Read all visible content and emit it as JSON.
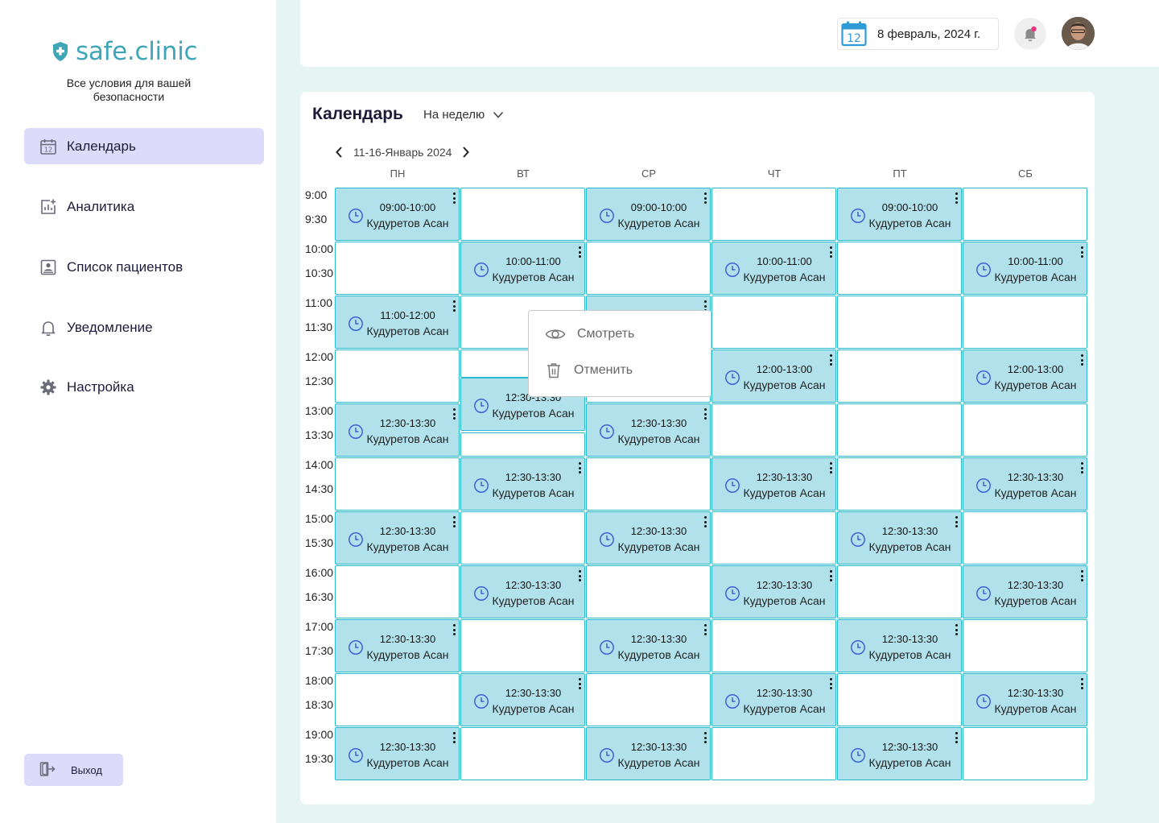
{
  "brand": {
    "name": "safe.clinic",
    "tagline": "Все условия для вашей безопасности",
    "color": "#3fa6b8"
  },
  "nav": {
    "items": [
      {
        "label": "Календарь",
        "icon": "calendar-icon",
        "active": true
      },
      {
        "label": "Аналитика",
        "icon": "analytics-icon",
        "active": false
      },
      {
        "label": "Список пациентов",
        "icon": "patients-list-icon",
        "active": false
      },
      {
        "label": "Уведомление",
        "icon": "bell-icon",
        "active": false
      },
      {
        "label": "Настройка",
        "icon": "gear-icon",
        "active": false
      }
    ],
    "logout_label": "Выход"
  },
  "header": {
    "date": "8 февраль, 2024 г.",
    "date_icon_day": "12",
    "notification_badge": true
  },
  "calendar": {
    "title": "Календарь",
    "view": "На неделю",
    "week_range": "11-16-Январь 2024",
    "days": [
      "ПН",
      "ВТ",
      "СР",
      "ЧТ",
      "ПТ",
      "СБ"
    ],
    "times": [
      "9:00",
      "9:30",
      "10:00",
      "10:30",
      "11:00",
      "11:30",
      "12:00",
      "12:30",
      "13:00",
      "13:30",
      "14:00",
      "14:30",
      "15:00",
      "15:30",
      "16:00",
      "16:30",
      "17:00",
      "17:30",
      "18:00",
      "18:30",
      "19:00",
      "19:30"
    ],
    "rows": [
      [
        {
          "time": "09:00-10:00",
          "name": "Кудуретов Асан"
        },
        null,
        {
          "time": "09:00-10:00",
          "name": "Кудуретов Асан"
        },
        null,
        {
          "time": "09:00-10:00",
          "name": "Кудуретов Асан"
        },
        null
      ],
      [
        null,
        {
          "time": "10:00-11:00",
          "name": "Кудуретов Асан"
        },
        null,
        {
          "time": "10:00-11:00",
          "name": "Кудуретов Асан"
        },
        null,
        {
          "time": "10:00-11:00",
          "name": "Кудуретов Асан"
        }
      ],
      [
        {
          "time": "11:00-12:00",
          "name": "Кудуретов Асан"
        },
        null,
        {
          "time": "",
          "name": ""
        },
        null,
        null,
        null
      ],
      [
        null,
        null,
        null,
        {
          "time": "12:00-13:00",
          "name": "Кудуретов Асан"
        },
        null,
        {
          "time": "12:00-13:00",
          "name": "Кудуретов Асан"
        }
      ],
      [
        {
          "time": "12:30-13:30",
          "name": "Кудуретов Асан"
        },
        null,
        {
          "time": "12:30-13:30",
          "name": "Кудуретов Асан"
        },
        null,
        null,
        null
      ],
      [
        null,
        {
          "time": "12:30-13:30",
          "name": "Кудуретов Асан"
        },
        null,
        {
          "time": "12:30-13:30",
          "name": "Кудуретов Асан"
        },
        null,
        {
          "time": "12:30-13:30",
          "name": "Кудуретов Асан"
        }
      ],
      [
        {
          "time": "12:30-13:30",
          "name": "Кудуретов Асан"
        },
        null,
        {
          "time": "12:30-13:30",
          "name": "Кудуретов Асан"
        },
        null,
        {
          "time": "12:30-13:30",
          "name": "Кудуретов Асан"
        },
        null
      ],
      [
        null,
        {
          "time": "12:30-13:30",
          "name": "Кудуретов Асан"
        },
        null,
        {
          "time": "12:30-13:30",
          "name": "Кудуретов Асан"
        },
        null,
        {
          "time": "12:30-13:30",
          "name": "Кудуретов Асан"
        }
      ],
      [
        {
          "time": "12:30-13:30",
          "name": "Кудуретов Асан"
        },
        null,
        {
          "time": "12:30-13:30",
          "name": "Кудуретов Асан"
        },
        null,
        {
          "time": "12:30-13:30",
          "name": "Кудуретов Асан"
        },
        null
      ],
      [
        null,
        {
          "time": "12:30-13:30",
          "name": "Кудуретов Асан"
        },
        null,
        {
          "time": "12:30-13:30",
          "name": "Кудуретов Асан"
        },
        null,
        {
          "time": "12:30-13:30",
          "name": "Кудуретов Асан"
        }
      ],
      [
        {
          "time": "12:30-13:30",
          "name": "Кудуретов Асан"
        },
        null,
        {
          "time": "12:30-13:30",
          "name": "Кудуретов Асан"
        },
        null,
        {
          "time": "12:30-13:30",
          "name": "Кудуретов Асан"
        },
        null
      ]
    ],
    "tuesday_split": {
      "time": "12:30-13:30",
      "name": "Кудуретов Асан"
    },
    "context_menu": {
      "view_label": "Смотреть",
      "cancel_label": "Отменить"
    }
  },
  "colors": {
    "booked": "#b1e2ec",
    "border": "#29b9cd",
    "active_nav": "#dcdbfa",
    "background": "#e6f5f3"
  }
}
